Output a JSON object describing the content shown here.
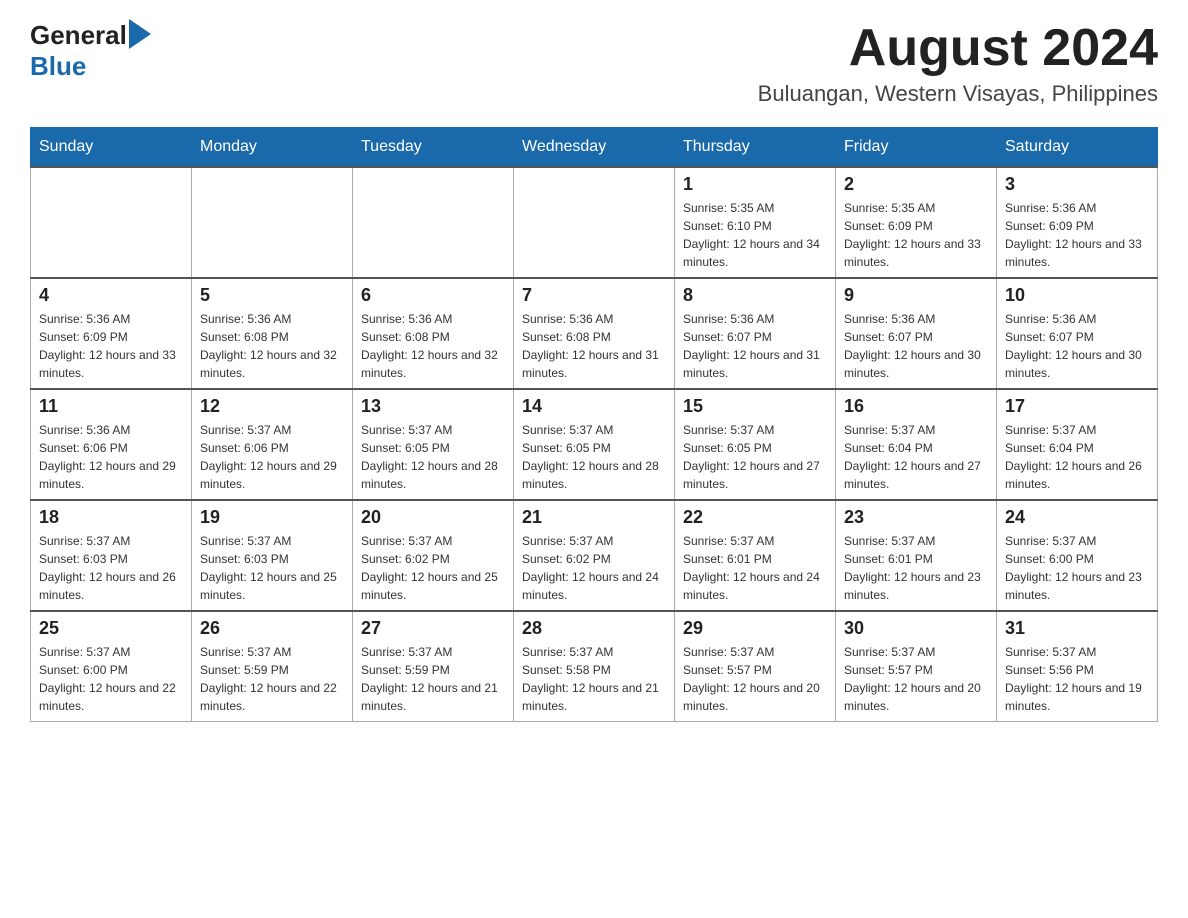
{
  "header": {
    "logo_general": "General",
    "logo_blue": "Blue",
    "month_year": "August 2024",
    "location": "Buluangan, Western Visayas, Philippines"
  },
  "calendar": {
    "days_of_week": [
      "Sunday",
      "Monday",
      "Tuesday",
      "Wednesday",
      "Thursday",
      "Friday",
      "Saturday"
    ],
    "weeks": [
      [
        {
          "day": "",
          "info": ""
        },
        {
          "day": "",
          "info": ""
        },
        {
          "day": "",
          "info": ""
        },
        {
          "day": "",
          "info": ""
        },
        {
          "day": "1",
          "info": "Sunrise: 5:35 AM\nSunset: 6:10 PM\nDaylight: 12 hours and 34 minutes."
        },
        {
          "day": "2",
          "info": "Sunrise: 5:35 AM\nSunset: 6:09 PM\nDaylight: 12 hours and 33 minutes."
        },
        {
          "day": "3",
          "info": "Sunrise: 5:36 AM\nSunset: 6:09 PM\nDaylight: 12 hours and 33 minutes."
        }
      ],
      [
        {
          "day": "4",
          "info": "Sunrise: 5:36 AM\nSunset: 6:09 PM\nDaylight: 12 hours and 33 minutes."
        },
        {
          "day": "5",
          "info": "Sunrise: 5:36 AM\nSunset: 6:08 PM\nDaylight: 12 hours and 32 minutes."
        },
        {
          "day": "6",
          "info": "Sunrise: 5:36 AM\nSunset: 6:08 PM\nDaylight: 12 hours and 32 minutes."
        },
        {
          "day": "7",
          "info": "Sunrise: 5:36 AM\nSunset: 6:08 PM\nDaylight: 12 hours and 31 minutes."
        },
        {
          "day": "8",
          "info": "Sunrise: 5:36 AM\nSunset: 6:07 PM\nDaylight: 12 hours and 31 minutes."
        },
        {
          "day": "9",
          "info": "Sunrise: 5:36 AM\nSunset: 6:07 PM\nDaylight: 12 hours and 30 minutes."
        },
        {
          "day": "10",
          "info": "Sunrise: 5:36 AM\nSunset: 6:07 PM\nDaylight: 12 hours and 30 minutes."
        }
      ],
      [
        {
          "day": "11",
          "info": "Sunrise: 5:36 AM\nSunset: 6:06 PM\nDaylight: 12 hours and 29 minutes."
        },
        {
          "day": "12",
          "info": "Sunrise: 5:37 AM\nSunset: 6:06 PM\nDaylight: 12 hours and 29 minutes."
        },
        {
          "day": "13",
          "info": "Sunrise: 5:37 AM\nSunset: 6:05 PM\nDaylight: 12 hours and 28 minutes."
        },
        {
          "day": "14",
          "info": "Sunrise: 5:37 AM\nSunset: 6:05 PM\nDaylight: 12 hours and 28 minutes."
        },
        {
          "day": "15",
          "info": "Sunrise: 5:37 AM\nSunset: 6:05 PM\nDaylight: 12 hours and 27 minutes."
        },
        {
          "day": "16",
          "info": "Sunrise: 5:37 AM\nSunset: 6:04 PM\nDaylight: 12 hours and 27 minutes."
        },
        {
          "day": "17",
          "info": "Sunrise: 5:37 AM\nSunset: 6:04 PM\nDaylight: 12 hours and 26 minutes."
        }
      ],
      [
        {
          "day": "18",
          "info": "Sunrise: 5:37 AM\nSunset: 6:03 PM\nDaylight: 12 hours and 26 minutes."
        },
        {
          "day": "19",
          "info": "Sunrise: 5:37 AM\nSunset: 6:03 PM\nDaylight: 12 hours and 25 minutes."
        },
        {
          "day": "20",
          "info": "Sunrise: 5:37 AM\nSunset: 6:02 PM\nDaylight: 12 hours and 25 minutes."
        },
        {
          "day": "21",
          "info": "Sunrise: 5:37 AM\nSunset: 6:02 PM\nDaylight: 12 hours and 24 minutes."
        },
        {
          "day": "22",
          "info": "Sunrise: 5:37 AM\nSunset: 6:01 PM\nDaylight: 12 hours and 24 minutes."
        },
        {
          "day": "23",
          "info": "Sunrise: 5:37 AM\nSunset: 6:01 PM\nDaylight: 12 hours and 23 minutes."
        },
        {
          "day": "24",
          "info": "Sunrise: 5:37 AM\nSunset: 6:00 PM\nDaylight: 12 hours and 23 minutes."
        }
      ],
      [
        {
          "day": "25",
          "info": "Sunrise: 5:37 AM\nSunset: 6:00 PM\nDaylight: 12 hours and 22 minutes."
        },
        {
          "day": "26",
          "info": "Sunrise: 5:37 AM\nSunset: 5:59 PM\nDaylight: 12 hours and 22 minutes."
        },
        {
          "day": "27",
          "info": "Sunrise: 5:37 AM\nSunset: 5:59 PM\nDaylight: 12 hours and 21 minutes."
        },
        {
          "day": "28",
          "info": "Sunrise: 5:37 AM\nSunset: 5:58 PM\nDaylight: 12 hours and 21 minutes."
        },
        {
          "day": "29",
          "info": "Sunrise: 5:37 AM\nSunset: 5:57 PM\nDaylight: 12 hours and 20 minutes."
        },
        {
          "day": "30",
          "info": "Sunrise: 5:37 AM\nSunset: 5:57 PM\nDaylight: 12 hours and 20 minutes."
        },
        {
          "day": "31",
          "info": "Sunrise: 5:37 AM\nSunset: 5:56 PM\nDaylight: 12 hours and 19 minutes."
        }
      ]
    ]
  }
}
